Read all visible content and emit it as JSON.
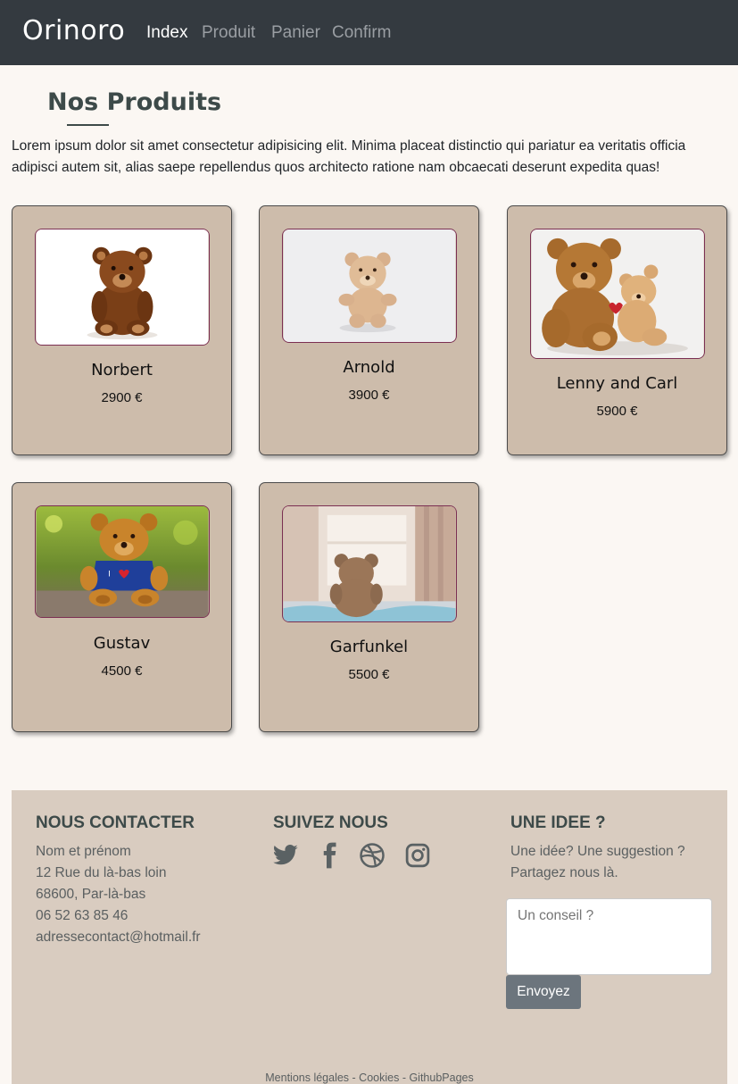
{
  "nav": {
    "brand": "Orinoro",
    "links": [
      {
        "label": "Index",
        "active": true
      },
      {
        "label": "Produit",
        "active": false
      },
      {
        "label": "Panier",
        "active": false
      },
      {
        "label": "Confirm",
        "active": false
      }
    ]
  },
  "main": {
    "title": "Nos Produits",
    "intro": "Lorem ipsum dolor sit amet consectetur adipisicing elit. Minima placeat distinctio qui pariatur ea veritatis officia adipisci autem sit, alias saepe repellendus quos architecto ratione nam obcaecati deserunt expedita quas!",
    "products": [
      {
        "name": "Norbert",
        "price": "2900 €",
        "image": "brown-teddy-bear-photo"
      },
      {
        "name": "Arnold",
        "price": "3900 €",
        "image": "beige-teddy-bear-photo"
      },
      {
        "name": "Lenny and Carl",
        "price": "5900 €",
        "image": "two-teddy-bears-photo"
      },
      {
        "name": "Gustav",
        "price": "4500 €",
        "image": "teddy-bear-blue-shirt-photo"
      },
      {
        "name": "Garfunkel",
        "price": "5500 €",
        "image": "teddy-bear-window-photo"
      }
    ]
  },
  "footer": {
    "contact": {
      "heading": "NOUS CONTACTER",
      "name": "Nom et prénom",
      "street": "12 Rue du là-bas loin",
      "city": "68600, Par-là-bas",
      "phone": "06 52 63 85 46",
      "email": "adressecontact@hotmail.fr"
    },
    "follow": {
      "heading": "SUIVEZ NOUS",
      "icons": [
        "twitter-icon",
        "facebook-icon",
        "dribbble-icon",
        "instagram-icon"
      ]
    },
    "idea": {
      "heading": "UNE IDEE ?",
      "text_line1": "Une idée? Une suggestion ?",
      "text_line2": "Partagez nous là.",
      "placeholder": "Un conseil ?",
      "button": "Envoyez"
    },
    "legal": {
      "mentions": "Mentions légales",
      "sep1": " - ",
      "cookies": "Cookies",
      "sep2": " - ",
      "github": "GithubPages"
    }
  },
  "colors": {
    "navbar": "#343a40",
    "card_bg": "#cdbcab",
    "footer_bg": "#d9ccc0",
    "heading": "#3d4a49",
    "button": "#6c757d"
  }
}
